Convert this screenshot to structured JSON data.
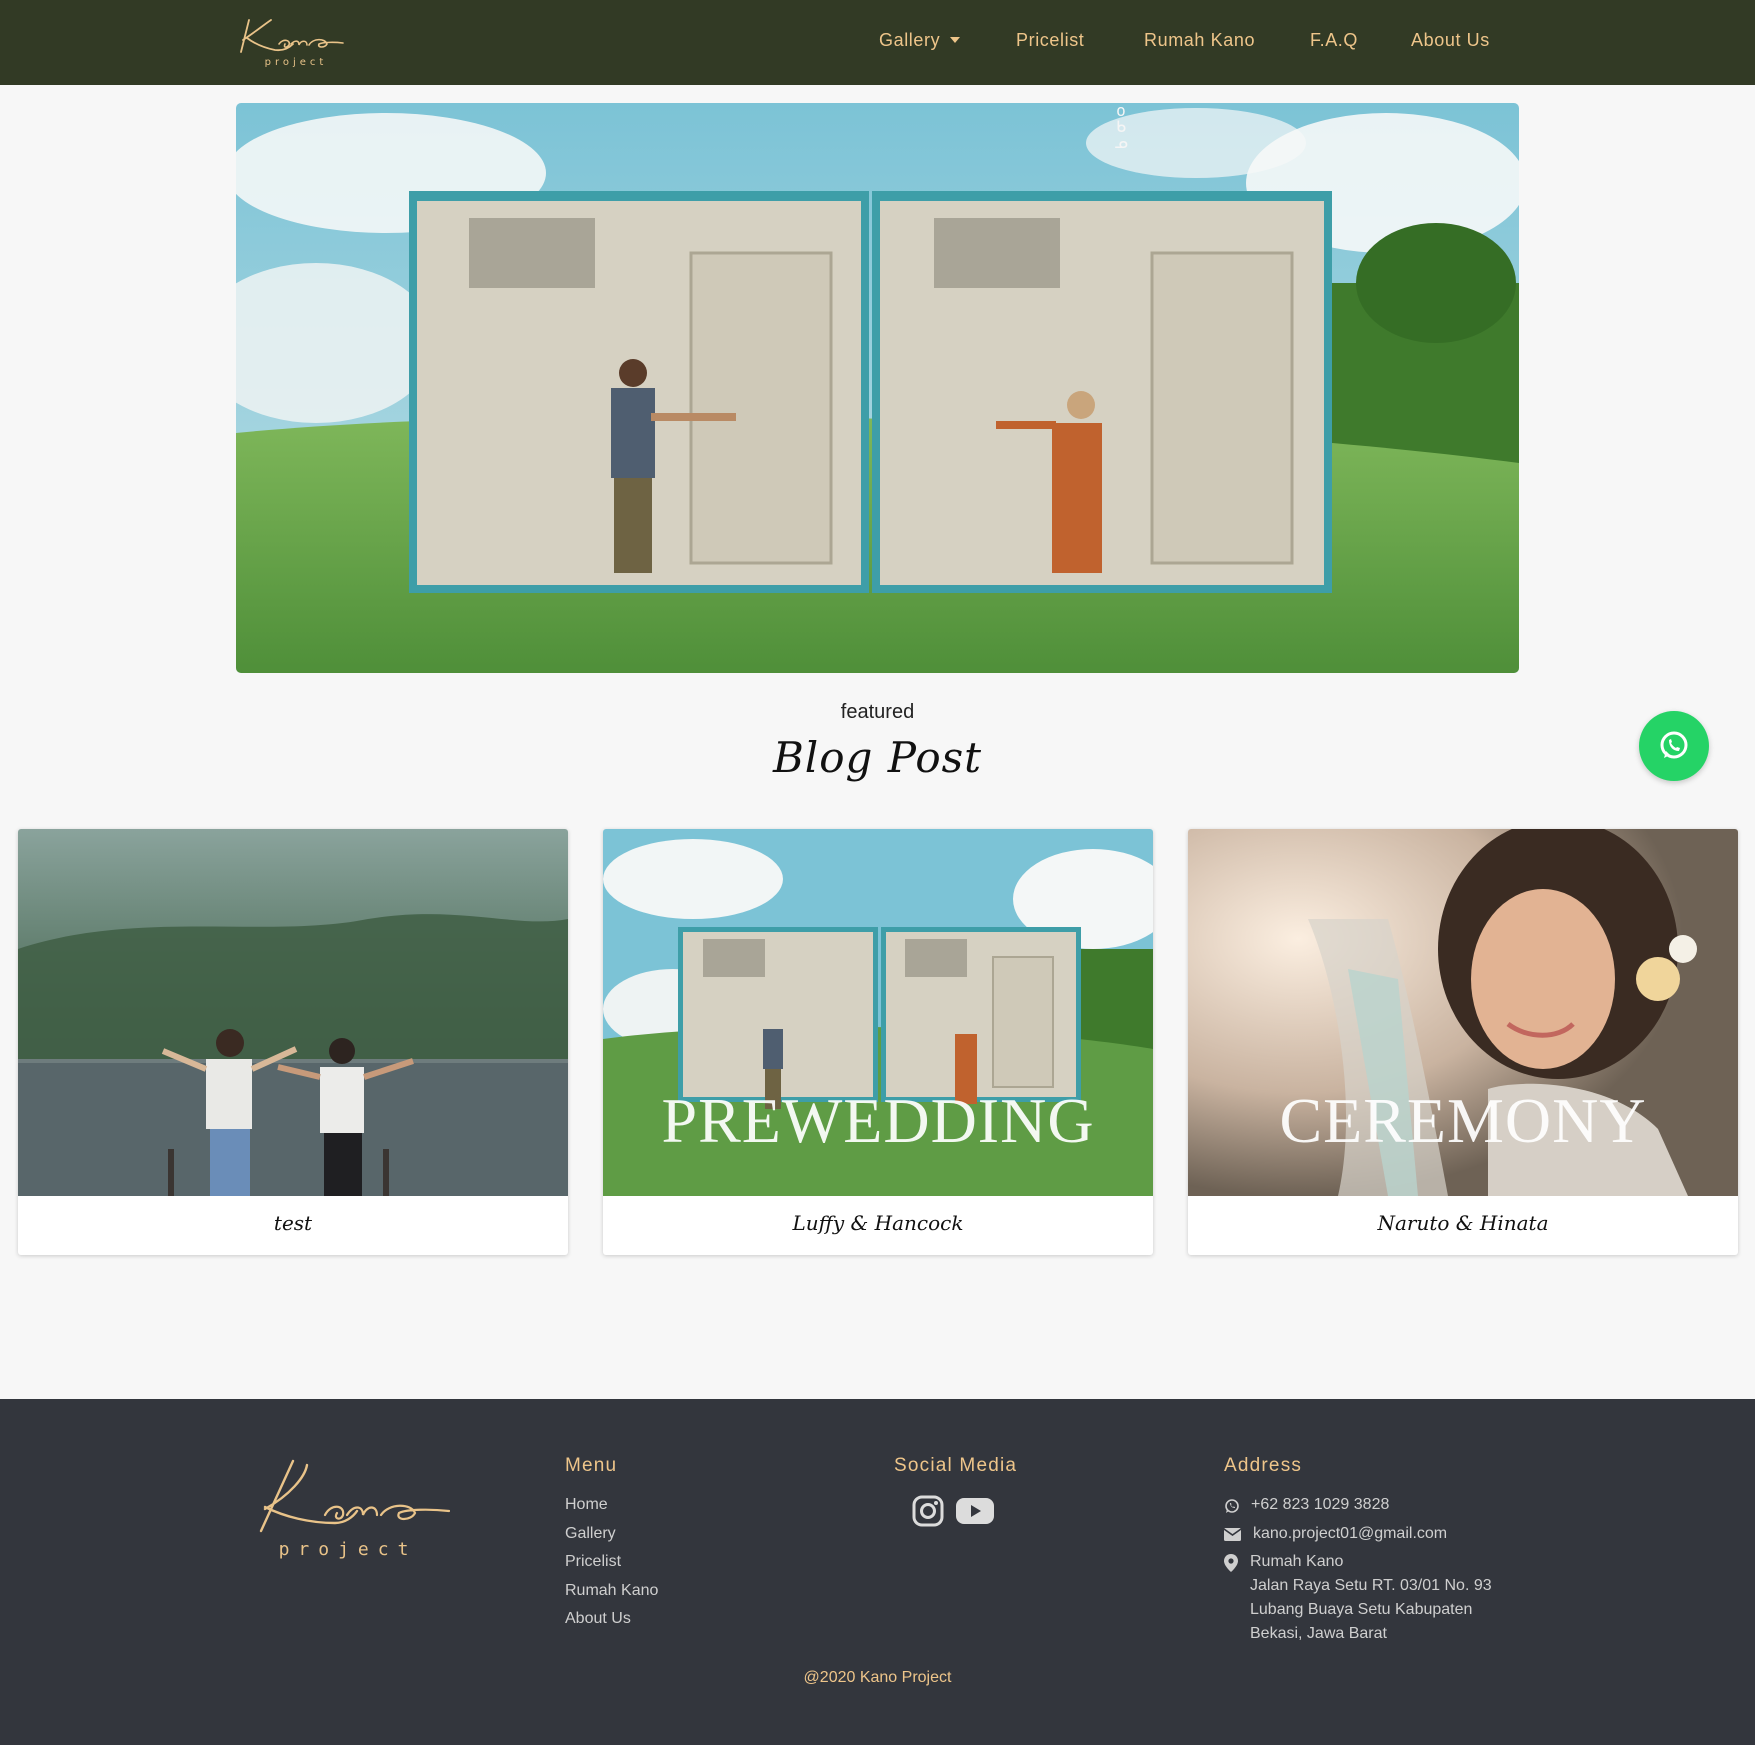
{
  "brand": {
    "name": "Kano",
    "sub": "project"
  },
  "nav": {
    "gallery": "Gallery",
    "pricelist": "Pricelist",
    "rumah_kano": "Rumah Kano",
    "faq": "F.A.Q",
    "about": "About Us"
  },
  "hero": {
    "vertical_text": [
      "o",
      "ᑲ",
      "ᓄ"
    ]
  },
  "featured": {
    "kicker": "featured",
    "title": "Blog Post"
  },
  "cards": [
    {
      "caption": "test",
      "overlay": ""
    },
    {
      "caption": "Luffy & Hancock",
      "overlay": "PREWEDDING"
    },
    {
      "caption": "Naruto & Hinata",
      "overlay": "CEREMONY"
    }
  ],
  "footer": {
    "menu_title": "Menu",
    "menu": [
      "Home",
      "Gallery",
      "Pricelist",
      "Rumah Kano",
      "About Us"
    ],
    "social_title": "Social Media",
    "address_title": "Address",
    "phone": "+62 823 1029 3828",
    "email": "kano.project01@gmail.com",
    "address": [
      "Rumah Kano",
      "Jalan Raya Setu RT. 03/01 No. 93",
      "Lubang Buaya Setu Kabupaten",
      "Bekasi, Jawa Barat"
    ],
    "copyright": "@2020 Kano Project"
  },
  "colors": {
    "navbar": "#323a25",
    "accent": "#eec58a",
    "footer": "#33363d",
    "whatsapp": "#25d366"
  },
  "icons": [
    "caret-down-icon",
    "whatsapp-icon",
    "instagram-icon",
    "youtube-icon",
    "phone-icon",
    "email-icon",
    "location-icon"
  ]
}
